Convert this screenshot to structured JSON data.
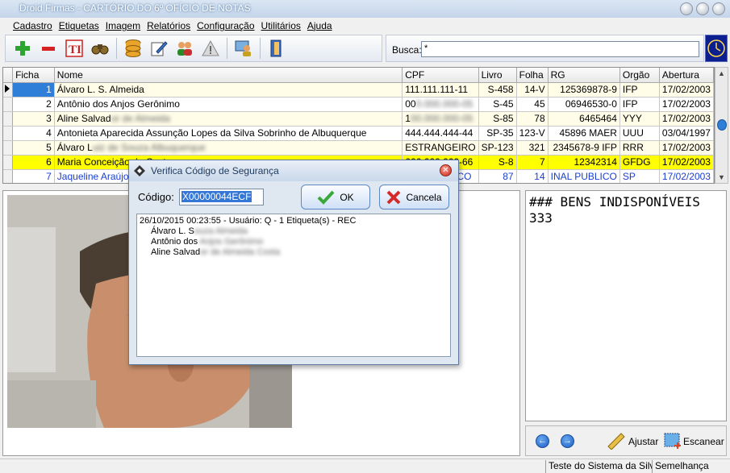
{
  "window": {
    "title": "Droid Firmas - CARTÓRIO DO 6º OFÍCIO DE NOTAS"
  },
  "menu": [
    "Cadastro",
    "Etiquetas",
    "Imagem",
    "Relatórios",
    "Configuração",
    "Utilitários",
    "Ajuda"
  ],
  "toolbar": {
    "icons": [
      "add-icon",
      "remove-icon",
      "text-icon",
      "binoculars-icon",
      "database-icon",
      "edit-icon",
      "users-icon",
      "warning-icon",
      "user-computer-icon",
      "door-exit-icon"
    ]
  },
  "search": {
    "label": "Busca:",
    "value": "*"
  },
  "grid": {
    "columns": [
      "Ficha",
      "Nome",
      "CPF",
      "Livro",
      "Folha",
      "RG",
      "Orgão",
      "Abertura"
    ],
    "rows": [
      {
        "ficha": "1",
        "nome": "Álvaro L. S. Almeida",
        "nome_blur": "",
        "cpf": "111.111.111-11",
        "cpf_blur": "",
        "livro": "S-458",
        "folha": "14-V",
        "rg": "125369878-9",
        "orgao": "IFP",
        "abertura": "17/02/2003"
      },
      {
        "ficha": "2",
        "nome": "Antônio dos Anjos Gerônimo",
        "nome_blur": "",
        "cpf": "00",
        "cpf_blur": "0.000.000-05",
        "livro": "S-45",
        "folha": "45",
        "rg": "06946530-0",
        "orgao": "IFP",
        "abertura": "17/02/2003"
      },
      {
        "ficha": "3",
        "nome": "Aline Salvad",
        "nome_blur": "or de Almeida",
        "cpf": "1",
        "cpf_blur": "00.000.000-05",
        "livro": "S-85",
        "folha": "78",
        "rg": "6465464",
        "orgao": "YYY",
        "abertura": "17/02/2003"
      },
      {
        "ficha": "4",
        "nome": "Antonieta Aparecida Assunção Lopes da Silva Sobrinho de Albuquerque",
        "nome_blur": "",
        "cpf": "444.444.444-44",
        "cpf_blur": "",
        "livro": "SP-35",
        "folha": "123-V",
        "rg": "45896 MAER",
        "orgao": "UUU",
        "abertura": "03/04/1997"
      },
      {
        "ficha": "5",
        "nome": "Álvaro L",
        "nome_blur": "uiz de Souza Albuquerque",
        "cpf": "ESTRANGEIRO",
        "cpf_blur": "",
        "livro": "SP-123",
        "folha": "321",
        "rg": "2345678-9 IFP",
        "orgao": "RRR",
        "abertura": "17/02/2003"
      },
      {
        "ficha": "6",
        "nome": "Maria Conceição da Costa",
        "nome_blur": "",
        "cpf": "666.666.666-66",
        "cpf_blur": "",
        "livro": "S-8",
        "folha": "7",
        "rg": "12342314",
        "orgao": "GFDG",
        "abertura": "17/02/2003"
      },
      {
        "ficha": "7",
        "nome": "Jaqueline Araújo A",
        "nome_blur": "",
        "cpf": "INAL PUBLICO",
        "cpf_blur": "",
        "livro": "87",
        "folha": "14",
        "rg": "INAL PUBLICO",
        "orgao": "SP",
        "abertura": "17/02/2003"
      }
    ]
  },
  "notes_text": "### BENS INDISPONÍVEIS\n333",
  "bottom_tools": {
    "adjust_label": "Ajustar",
    "scan_label": "Escanear"
  },
  "status": [
    "",
    "Teste do Sistema da Silva",
    "Semelhança"
  ],
  "dialog": {
    "title": "Verifica Código de Segurança",
    "code_label": "Código:",
    "code_value": "X00000044ECF",
    "ok_label": "OK",
    "cancel_label": "Cancela",
    "log_header": "26/10/2015 00:23:55  -  Usuário: Q  -  1 Etiqueta(s)  - REC",
    "log_entries": [
      {
        "visible": "Álvaro L. S",
        "blur": "ouza Almeida"
      },
      {
        "visible": "Antônio dos",
        "blur": " Anjos Gerônimo"
      },
      {
        "visible": "Aline Salvad",
        "blur": "or de Almeida Costa"
      }
    ]
  },
  "colors": {
    "title_bar": "#c4d5ea",
    "selection": "#2f7fd9",
    "row_highlight": "#ffff00",
    "row_odd": "#fffde8",
    "link_blue": "#1a3fcf",
    "dialog_bg": "#dfe7f1"
  }
}
